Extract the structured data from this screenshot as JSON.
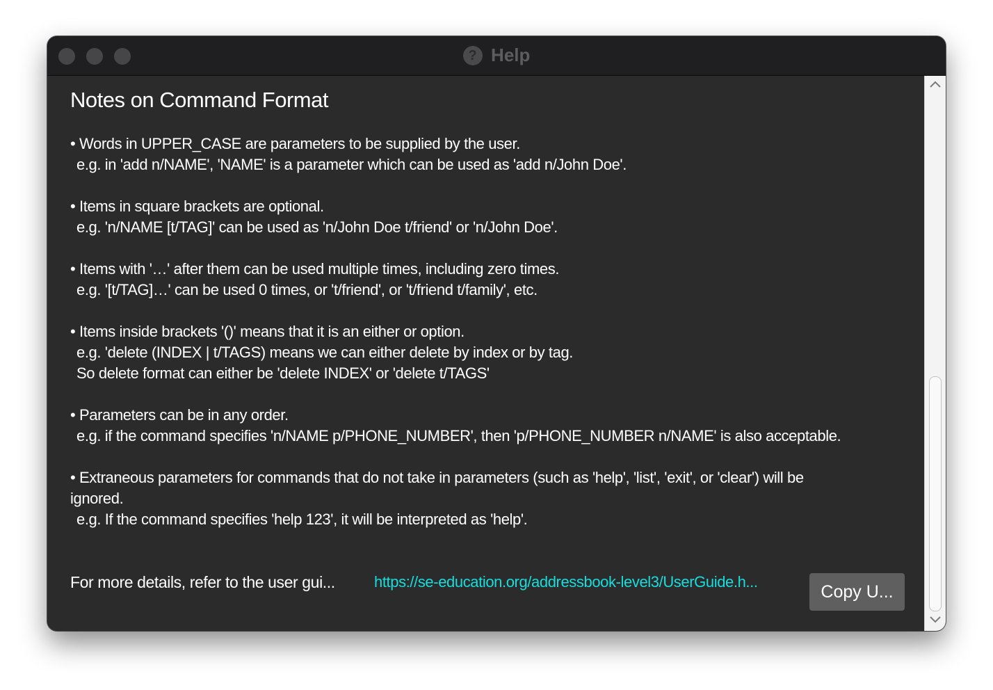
{
  "window": {
    "title": "Help",
    "title_icon": "?"
  },
  "help": {
    "heading": "Notes on Command Format",
    "notes": [
      {
        "lines": [
          "• Words in UPPER_CASE are parameters to be supplied by the user.",
          "e.g. in 'add n/NAME', 'NAME' is a parameter which can be used as 'add n/John Doe'."
        ]
      },
      {
        "lines": [
          "• Items in square brackets are optional.",
          "e.g. 'n/NAME [t/TAG]' can be used as 'n/John Doe t/friend' or 'n/John Doe'."
        ]
      },
      {
        "lines": [
          "• Items with '…' after them can be used multiple times, including zero times.",
          "e.g. '[t/TAG]…' can be used 0 times, or 't/friend', or 't/friend t/family', etc."
        ]
      },
      {
        "lines": [
          "• Items inside brackets '()' means that it is an either or option.",
          "e.g. 'delete (INDEX | t/TAGS) means we can either delete by index or by tag.",
          "So delete format can either be 'delete INDEX' or 'delete t/TAGS'"
        ]
      },
      {
        "lines": [
          "• Parameters can be in any order.",
          "e.g. if the command specifies 'n/NAME p/PHONE_NUMBER', then 'p/PHONE_NUMBER n/NAME' is also acceptable."
        ]
      },
      {
        "lines": [
          "• Extraneous parameters for commands that do not take in parameters (such as 'help', 'list', 'exit', or 'clear') will be",
          "ignored.",
          "e.g. If the command specifies 'help 123', it will be interpreted as 'help'."
        ]
      }
    ]
  },
  "footer": {
    "text": "For more details, refer to the user gui...",
    "link": "https://se-education.org/addressbook-level3/UserGuide.h...",
    "copy_button": "Copy U..."
  },
  "colors": {
    "background": "#2b2b2b",
    "titlebar": "#1f1f21",
    "link": "#19dcdc",
    "button": "#5f5f5f"
  },
  "icons": {
    "scroll_up": "chevron-up-icon",
    "scroll_down": "chevron-down-icon",
    "help": "question-icon"
  }
}
